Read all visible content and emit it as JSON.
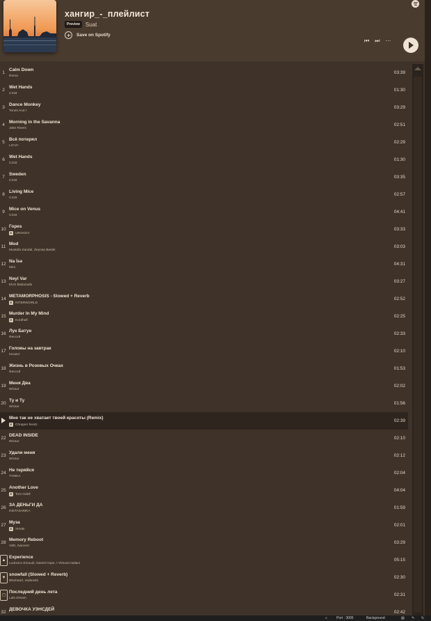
{
  "playlist": {
    "title": "хангир_-_плейлист",
    "preview_badge": "Preview",
    "owner": "Suat",
    "save_label": "Save on Spotify"
  },
  "controls": {
    "prev_icon": "previous-track-icon",
    "next_icon": "next-track-icon",
    "more_icon": "more-options-icon",
    "play_icon": "play-icon"
  },
  "tracks": [
    {
      "num": "1",
      "name": "Calm Down",
      "artist": "Rema",
      "duration": "03:39",
      "explicit": false
    },
    {
      "num": "2",
      "name": "Wet Hands",
      "artist": "C418",
      "duration": "01:30",
      "explicit": false
    },
    {
      "num": "3",
      "name": "Dance Monkey",
      "artist": "Tones And I",
      "duration": "03:29",
      "explicit": false
    },
    {
      "num": "4",
      "name": "Morning in the Savanna",
      "artist": "Jake Rivers",
      "duration": "02:51",
      "explicit": false
    },
    {
      "num": "5",
      "name": "Всё потерял",
      "artist": "LICVA",
      "duration": "02:29",
      "explicit": false
    },
    {
      "num": "6",
      "name": "Wet Hands",
      "artist": "C418",
      "duration": "01:30",
      "explicit": false
    },
    {
      "num": "7",
      "name": "Sweden",
      "artist": "C418",
      "duration": "03:35",
      "explicit": false
    },
    {
      "num": "8",
      "name": "Living Mice",
      "artist": "C418",
      "duration": "02:57",
      "explicit": false
    },
    {
      "num": "9",
      "name": "Mice on Venus",
      "artist": "C418",
      "duration": "04:41",
      "explicit": false
    },
    {
      "num": "10",
      "name": "Гореs",
      "artist": "URANOV",
      "duration": "03:33",
      "explicit": true
    },
    {
      "num": "11",
      "name": "Mod",
      "artist": "Mustafa Sandal, Zeynep Bastık",
      "duration": "03:03",
      "explicit": false
    },
    {
      "num": "12",
      "name": "Na İsə",
      "artist": "Miro",
      "duration": "04:31",
      "explicit": false
    },
    {
      "num": "13",
      "name": "Nəyi Var",
      "artist": "Elvin Babazadə",
      "duration": "03:27",
      "explicit": false
    },
    {
      "num": "14",
      "name": "METAMORPHOSIS - Slowed + Reverb",
      "artist": "INTERWORLD",
      "duration": "02:52",
      "explicit": true
    },
    {
      "num": "15",
      "name": "Murder In My Mind",
      "artist": "Kordhell",
      "duration": "02:25",
      "explicit": true
    },
    {
      "num": "16",
      "name": "Лук Батун",
      "artist": "Фиєсхй",
      "duration": "02:33",
      "explicit": false
    },
    {
      "num": "17",
      "name": "Головы на завтрак",
      "artist": "Космот",
      "duration": "02:10",
      "explicit": false
    },
    {
      "num": "18",
      "name": "Жизнь в Розовых Очках",
      "artist": "Фиєсхй",
      "duration": "01:53",
      "explicit": false
    },
    {
      "num": "19",
      "name": "Меня Два",
      "artist": "Wicsur",
      "duration": "02:02",
      "explicit": false
    },
    {
      "num": "20",
      "name": "Ту и Ту",
      "artist": "Wicsur",
      "duration": "01:56",
      "explicit": false
    },
    {
      "num": "",
      "name": "Мне так не хватает твоей красоты (Remix)",
      "artist": "Chopper beatz.",
      "duration": "02:39",
      "explicit": true,
      "active": true
    },
    {
      "num": "22",
      "name": "DEAD INSIDE",
      "artist": "Wicsur",
      "duration": "02:10",
      "explicit": false
    },
    {
      "num": "23",
      "name": "Удали меня",
      "artist": "Wicsur",
      "duration": "02:12",
      "explicit": false
    },
    {
      "num": "24",
      "name": "Не теряйся",
      "artist": "TVMKA",
      "duration": "02:04",
      "explicit": false
    },
    {
      "num": "25",
      "name": "Another Love",
      "artist": "Tom Odell",
      "duration": "04:04",
      "explicit": true
    },
    {
      "num": "26",
      "name": "ЗА ДЕНЬГИ ДА",
      "artist": "INSTASAMKA",
      "duration": "01:59",
      "explicit": false
    },
    {
      "num": "27",
      "name": "Муза",
      "artist": "УННВ",
      "duration": "02:01",
      "explicit": true
    },
    {
      "num": "28",
      "name": "Memory Reboot",
      "artist": "VØJ, Narvent",
      "duration": "03:29",
      "explicit": false
    },
    {
      "num": "",
      "name": "Experience",
      "artist": "Ludovico Einaudi, Daniel Hope, I Virtuosi Italiani",
      "duration": "05:15",
      "explicit": false,
      "icon": "▲"
    },
    {
      "num": "",
      "name": "snowfall (Slowed + Reverb)",
      "artist": "Øneheart, reidenshi",
      "duration": "02:30",
      "explicit": false,
      "icon": "▼"
    },
    {
      "num": "",
      "name": "Последний день лета",
      "artist": "Lalo Dream",
      "duration": "02:31",
      "explicit": false,
      "icon": "◻"
    },
    {
      "num": "32",
      "name": "ДЕВОЧКА УЭНСДЕЙ",
      "artist": "",
      "duration": "02:42",
      "explicit": false
    }
  ],
  "statusbar": {
    "port": "Port : 3000",
    "background": "Background"
  },
  "colors": {
    "background": "#3f3329",
    "header": "#4a3b2f",
    "active_row": "#2e251f",
    "text": "#f0e4d5"
  }
}
